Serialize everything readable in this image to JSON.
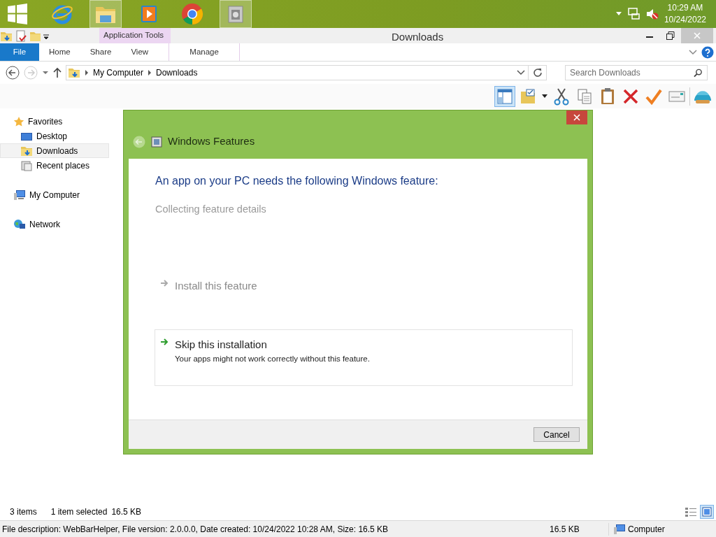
{
  "taskbar": {
    "apps": [
      {
        "kind": "start",
        "selected": false
      },
      {
        "kind": "browser",
        "selected": false
      },
      {
        "kind": "explorer",
        "selected": true
      },
      {
        "kind": "media",
        "selected": false
      },
      {
        "kind": "chrome",
        "selected": false
      },
      {
        "kind": "installer",
        "selected": true
      }
    ],
    "clock": {
      "time": "10:29 AM",
      "date": "10/24/2022"
    }
  },
  "window": {
    "title": "Downloads",
    "contextual_tab_group": "Application Tools"
  },
  "ribbon": {
    "tabs": [
      {
        "label": "File",
        "kind": "file",
        "selected": false
      },
      {
        "label": "Home",
        "kind": "plain",
        "selected": false
      },
      {
        "label": "Share",
        "kind": "plain",
        "selected": false
      },
      {
        "label": "View",
        "kind": "plain",
        "selected": false
      },
      {
        "label": "Manage",
        "kind": "contextual",
        "selected": false
      }
    ]
  },
  "address": {
    "path": [
      "My Computer",
      "Downloads"
    ],
    "search": {
      "placeholder": "Search Downloads"
    }
  },
  "toolbar": {
    "pane_toggle": {
      "on": true
    },
    "buttons": [
      {
        "kind": "folder-check"
      },
      {
        "kind": "dropdown"
      },
      {
        "kind": "cut"
      },
      {
        "kind": "copy"
      },
      {
        "kind": "paste"
      },
      {
        "kind": "delete"
      },
      {
        "kind": "tick"
      },
      {
        "kind": "mail"
      },
      {
        "kind": "shell"
      }
    ]
  },
  "nav_pane": {
    "items": [
      {
        "label": "Favorites",
        "kind": "star",
        "selected": false,
        "children": [
          {
            "label": "Desktop",
            "kind": "desktop",
            "selected": false
          },
          {
            "label": "Downloads",
            "kind": "downloads",
            "selected": true
          },
          {
            "label": "Recent places",
            "kind": "recent",
            "selected": false
          }
        ]
      },
      {
        "label": "My Computer",
        "kind": "computer",
        "selected": false
      },
      {
        "label": "Network",
        "kind": "network",
        "selected": false
      }
    ]
  },
  "dialog": {
    "title": "Windows Features",
    "heading": "An app on your PC needs the following Windows feature:",
    "status": "Collecting feature details",
    "options": [
      {
        "title": "Install this feature",
        "disabled": true,
        "focused": false
      },
      {
        "title": "Skip this installation",
        "description": "Your apps might not work correctly without this feature.",
        "disabled": false,
        "focused": true
      }
    ],
    "cancel": "Cancel"
  },
  "status": {
    "item_count": "3 items",
    "selection": "1 item selected",
    "selection_size": "16.5 KB",
    "view_buttons": [
      {
        "kind": "details",
        "selected": false
      },
      {
        "kind": "tiles",
        "selected": true
      }
    ]
  },
  "details_bar": {
    "description": "File description: WebBarHelper, File version: 2.0.0.0, Date created: 10/24/2022 10:28 AM, Size: 16.5 KB",
    "size": "16.5 KB",
    "zone": "Computer"
  }
}
